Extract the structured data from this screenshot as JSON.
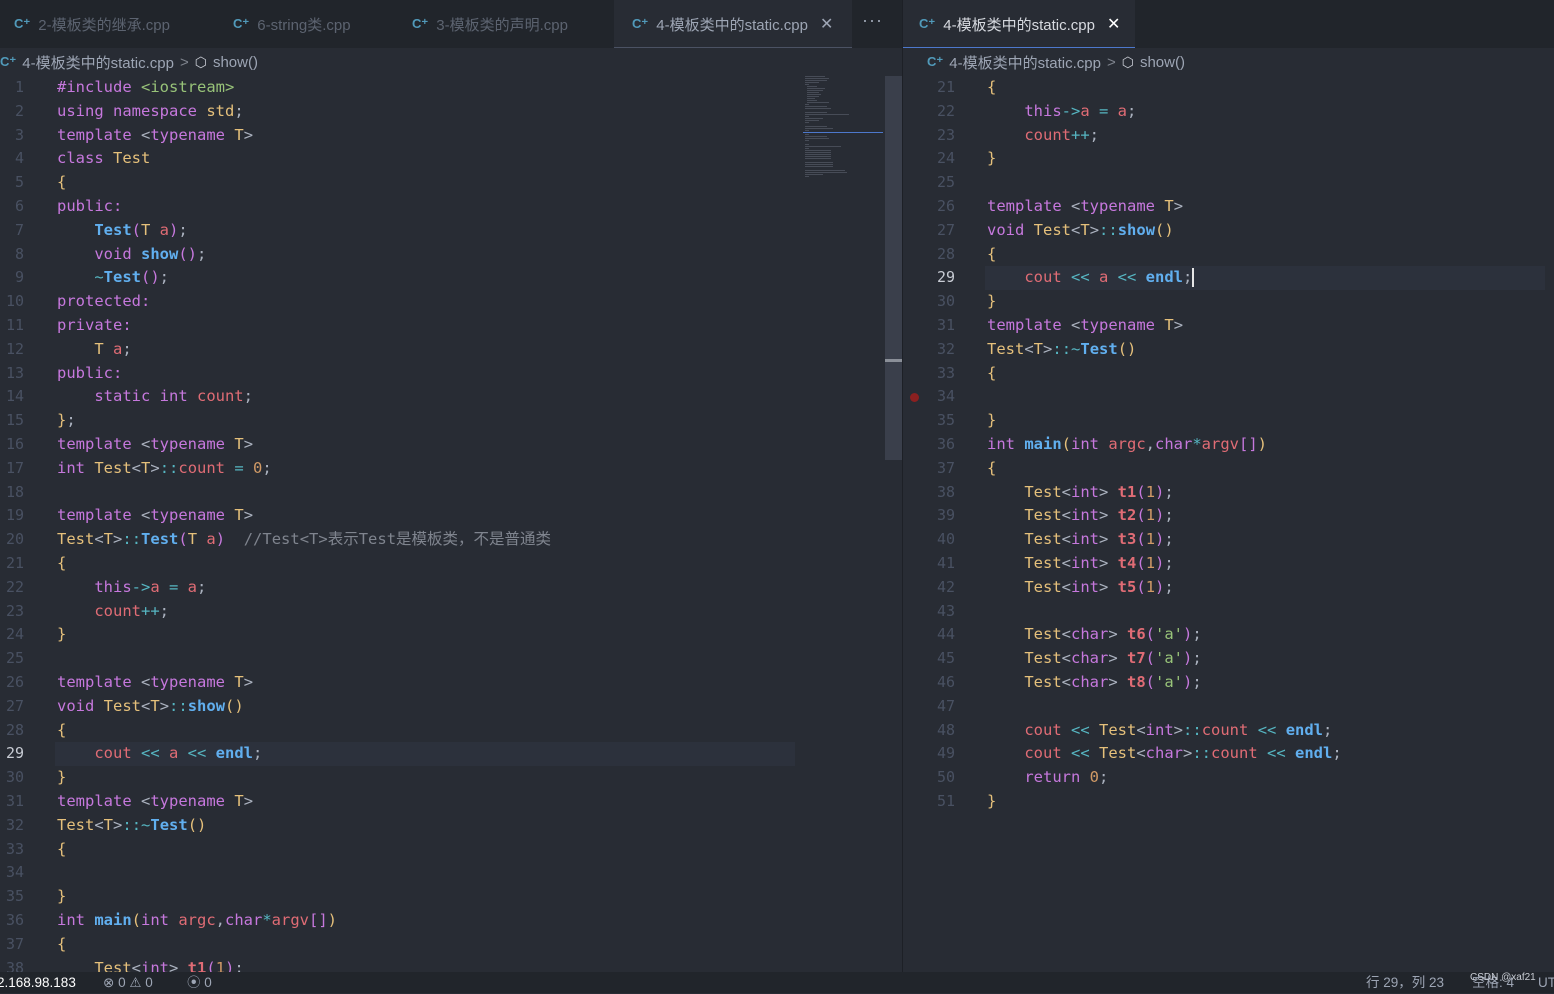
{
  "tabs_left": [
    {
      "label": "2-模板类的继承.cpp",
      "icon": "cpp-file-icon",
      "active": false
    },
    {
      "label": "6-string类.cpp",
      "icon": "cpp-file-icon",
      "active": false
    },
    {
      "label": "3-模板类的声明.cpp",
      "icon": "cpp-file-icon",
      "active": false
    },
    {
      "label": "4-模板类中的static.cpp",
      "icon": "cpp-file-icon",
      "active": false
    }
  ],
  "tab_right": {
    "label": "4-模板类中的static.cpp",
    "icon": "cpp-file-icon",
    "active": true
  },
  "more_actions": "···",
  "close_glyph": "✕",
  "breadcrumb": {
    "file": "4-模板类中的static.cpp",
    "symbol": "show()",
    "separator": ">"
  },
  "left_editor": {
    "first_line": 1,
    "current_line": 29,
    "lines": [
      [
        [
          "#include ",
          "kw"
        ],
        [
          "<iostream>",
          "st"
        ]
      ],
      [
        [
          "using ",
          "kw"
        ],
        [
          "namespace ",
          "kw"
        ],
        [
          "std",
          "ty"
        ],
        [
          ";",
          "pl"
        ]
      ],
      [
        [
          "template ",
          "kw"
        ],
        [
          "<",
          "pl"
        ],
        [
          "typename ",
          "kw"
        ],
        [
          "T",
          "ty"
        ],
        [
          ">",
          "pl"
        ]
      ],
      [
        [
          "class ",
          "kw"
        ],
        [
          "Test",
          "ty"
        ]
      ],
      [
        [
          "{",
          "b1"
        ]
      ],
      [
        [
          "public:",
          "kw"
        ]
      ],
      [
        [
          "    ",
          "pl"
        ],
        [
          "Test",
          "fn"
        ],
        [
          "(",
          "b2"
        ],
        [
          "T ",
          "ty"
        ],
        [
          "a",
          "va"
        ],
        [
          ")",
          "b2"
        ],
        [
          ";",
          "pl"
        ]
      ],
      [
        [
          "    ",
          "pl"
        ],
        [
          "void ",
          "kw"
        ],
        [
          "show",
          "fn"
        ],
        [
          "()",
          "b2"
        ],
        [
          ";",
          "pl"
        ]
      ],
      [
        [
          "    ",
          "pl"
        ],
        [
          "~",
          "op"
        ],
        [
          "Test",
          "fn"
        ],
        [
          "()",
          "b2"
        ],
        [
          ";",
          "pl"
        ]
      ],
      [
        [
          "protected:",
          "kw"
        ]
      ],
      [
        [
          "private:",
          "kw"
        ]
      ],
      [
        [
          "    ",
          "pl"
        ],
        [
          "T ",
          "ty"
        ],
        [
          "a",
          "va"
        ],
        [
          ";",
          "pl"
        ]
      ],
      [
        [
          "public:",
          "kw"
        ]
      ],
      [
        [
          "    ",
          "pl"
        ],
        [
          "static ",
          "kw"
        ],
        [
          "int ",
          "kw"
        ],
        [
          "count",
          "va"
        ],
        [
          ";",
          "pl"
        ]
      ],
      [
        [
          "}",
          "b1"
        ],
        [
          ";",
          "pl"
        ]
      ],
      [
        [
          "template ",
          "kw"
        ],
        [
          "<",
          "pl"
        ],
        [
          "typename ",
          "kw"
        ],
        [
          "T",
          "ty"
        ],
        [
          ">",
          "pl"
        ]
      ],
      [
        [
          "int ",
          "kw"
        ],
        [
          "Test",
          "ty"
        ],
        [
          "<",
          "pl"
        ],
        [
          "T",
          "ty"
        ],
        [
          ">",
          "pl"
        ],
        [
          "::",
          "op"
        ],
        [
          "count ",
          "va"
        ],
        [
          "= ",
          "op"
        ],
        [
          "0",
          "nu"
        ],
        [
          ";",
          "pl"
        ]
      ],
      [],
      [
        [
          "template ",
          "kw"
        ],
        [
          "<",
          "pl"
        ],
        [
          "typename ",
          "kw"
        ],
        [
          "T",
          "ty"
        ],
        [
          ">",
          "pl"
        ]
      ],
      [
        [
          "Test",
          "ty"
        ],
        [
          "<",
          "pl"
        ],
        [
          "T",
          "ty"
        ],
        [
          ">",
          "pl"
        ],
        [
          "::",
          "op"
        ],
        [
          "Test",
          "fn"
        ],
        [
          "(",
          "b2"
        ],
        [
          "T ",
          "ty"
        ],
        [
          "a",
          "va"
        ],
        [
          ")",
          "b2"
        ],
        [
          "  //Test<T>表示Test是模板类，不是普通类",
          "cm"
        ]
      ],
      [
        [
          "{",
          "b1"
        ]
      ],
      [
        [
          "    ",
          "pl"
        ],
        [
          "this",
          "kw"
        ],
        [
          "->",
          "op"
        ],
        [
          "a ",
          "va"
        ],
        [
          "= ",
          "op"
        ],
        [
          "a",
          "va"
        ],
        [
          ";",
          "pl"
        ]
      ],
      [
        [
          "    ",
          "pl"
        ],
        [
          "count",
          "va"
        ],
        [
          "++",
          "op"
        ],
        [
          ";",
          "pl"
        ]
      ],
      [
        [
          "}",
          "b1"
        ]
      ],
      [],
      [
        [
          "template ",
          "kw"
        ],
        [
          "<",
          "pl"
        ],
        [
          "typename ",
          "kw"
        ],
        [
          "T",
          "ty"
        ],
        [
          ">",
          "pl"
        ]
      ],
      [
        [
          "void ",
          "kw"
        ],
        [
          "Test",
          "ty"
        ],
        [
          "<",
          "pl"
        ],
        [
          "T",
          "ty"
        ],
        [
          ">",
          "pl"
        ],
        [
          "::",
          "op"
        ],
        [
          "show",
          "fn"
        ],
        [
          "()",
          "b1"
        ]
      ],
      [
        [
          "{",
          "b1"
        ]
      ],
      [
        [
          "    ",
          "pl"
        ],
        [
          "cout ",
          "va"
        ],
        [
          "<< ",
          "op"
        ],
        [
          "a ",
          "va"
        ],
        [
          "<< ",
          "op"
        ],
        [
          "endl",
          "fn"
        ],
        [
          ";",
          "pl"
        ]
      ],
      [
        [
          "}",
          "b1"
        ]
      ],
      [
        [
          "template ",
          "kw"
        ],
        [
          "<",
          "pl"
        ],
        [
          "typename ",
          "kw"
        ],
        [
          "T",
          "ty"
        ],
        [
          ">",
          "pl"
        ]
      ],
      [
        [
          "Test",
          "ty"
        ],
        [
          "<",
          "pl"
        ],
        [
          "T",
          "ty"
        ],
        [
          ">",
          "pl"
        ],
        [
          "::",
          "op"
        ],
        [
          "~",
          "op"
        ],
        [
          "Test",
          "fn"
        ],
        [
          "()",
          "b1"
        ]
      ],
      [
        [
          "{",
          "b1"
        ]
      ],
      [],
      [
        [
          "}",
          "b1"
        ]
      ],
      [
        [
          "int ",
          "kw"
        ],
        [
          "main",
          "fn"
        ],
        [
          "(",
          "b1"
        ],
        [
          "int ",
          "kw"
        ],
        [
          "argc",
          "va"
        ],
        [
          ",",
          "pl"
        ],
        [
          "char",
          "kw"
        ],
        [
          "*",
          "op"
        ],
        [
          "argv",
          "va"
        ],
        [
          "[]",
          "b2"
        ],
        [
          ")",
          "b1"
        ]
      ],
      [
        [
          "{",
          "b1"
        ]
      ],
      [
        [
          "    ",
          "pl"
        ],
        [
          "Test",
          "ty"
        ],
        [
          "<",
          "pl"
        ],
        [
          "int",
          "kw"
        ],
        [
          "> ",
          "pl"
        ],
        [
          "t1",
          "fnb"
        ],
        [
          "(",
          "b2"
        ],
        [
          "1",
          "nu"
        ],
        [
          ")",
          "b2"
        ],
        [
          ";",
          "pl"
        ]
      ]
    ]
  },
  "right_editor": {
    "first_line": 21,
    "current_line": 29,
    "breakpoint_line": 34,
    "lines": [
      [
        [
          "{",
          "b1"
        ]
      ],
      [
        [
          "    ",
          "pl"
        ],
        [
          "this",
          "kw"
        ],
        [
          "->",
          "op"
        ],
        [
          "a ",
          "va"
        ],
        [
          "= ",
          "op"
        ],
        [
          "a",
          "va"
        ],
        [
          ";",
          "pl"
        ]
      ],
      [
        [
          "    ",
          "pl"
        ],
        [
          "count",
          "va"
        ],
        [
          "++",
          "op"
        ],
        [
          ";",
          "pl"
        ]
      ],
      [
        [
          "}",
          "b1"
        ]
      ],
      [],
      [
        [
          "template ",
          "kw"
        ],
        [
          "<",
          "pl"
        ],
        [
          "typename ",
          "kw"
        ],
        [
          "T",
          "ty"
        ],
        [
          ">",
          "pl"
        ]
      ],
      [
        [
          "void ",
          "kw"
        ],
        [
          "Test",
          "ty"
        ],
        [
          "<",
          "pl"
        ],
        [
          "T",
          "ty"
        ],
        [
          ">",
          "pl"
        ],
        [
          "::",
          "op"
        ],
        [
          "show",
          "fn"
        ],
        [
          "()",
          "b1"
        ]
      ],
      [
        [
          "{",
          "b1"
        ]
      ],
      [
        [
          "    ",
          "pl"
        ],
        [
          "cout ",
          "va"
        ],
        [
          "<< ",
          "op"
        ],
        [
          "a ",
          "va"
        ],
        [
          "<< ",
          "op"
        ],
        [
          "endl",
          "fn"
        ],
        [
          ";",
          "pl"
        ]
      ],
      [
        [
          "}",
          "b1"
        ]
      ],
      [
        [
          "template ",
          "kw"
        ],
        [
          "<",
          "pl"
        ],
        [
          "typename ",
          "kw"
        ],
        [
          "T",
          "ty"
        ],
        [
          ">",
          "pl"
        ]
      ],
      [
        [
          "Test",
          "ty"
        ],
        [
          "<",
          "pl"
        ],
        [
          "T",
          "ty"
        ],
        [
          ">",
          "pl"
        ],
        [
          "::",
          "op"
        ],
        [
          "~",
          "op"
        ],
        [
          "Test",
          "fn"
        ],
        [
          "()",
          "b1"
        ]
      ],
      [
        [
          "{",
          "b1"
        ]
      ],
      [],
      [
        [
          "}",
          "b1"
        ]
      ],
      [
        [
          "int ",
          "kw"
        ],
        [
          "main",
          "fn"
        ],
        [
          "(",
          "b1"
        ],
        [
          "int ",
          "kw"
        ],
        [
          "argc",
          "va"
        ],
        [
          ",",
          "pl"
        ],
        [
          "char",
          "kw"
        ],
        [
          "*",
          "op"
        ],
        [
          "argv",
          "va"
        ],
        [
          "[]",
          "b2"
        ],
        [
          ")",
          "b1"
        ]
      ],
      [
        [
          "{",
          "b1"
        ]
      ],
      [
        [
          "    ",
          "pl"
        ],
        [
          "Test",
          "ty"
        ],
        [
          "<",
          "pl"
        ],
        [
          "int",
          "kw"
        ],
        [
          "> ",
          "pl"
        ],
        [
          "t1",
          "fnb"
        ],
        [
          "(",
          "b2"
        ],
        [
          "1",
          "nu"
        ],
        [
          ")",
          "b2"
        ],
        [
          ";",
          "pl"
        ]
      ],
      [
        [
          "    ",
          "pl"
        ],
        [
          "Test",
          "ty"
        ],
        [
          "<",
          "pl"
        ],
        [
          "int",
          "kw"
        ],
        [
          "> ",
          "pl"
        ],
        [
          "t2",
          "fnb"
        ],
        [
          "(",
          "b2"
        ],
        [
          "1",
          "nu"
        ],
        [
          ")",
          "b2"
        ],
        [
          ";",
          "pl"
        ]
      ],
      [
        [
          "    ",
          "pl"
        ],
        [
          "Test",
          "ty"
        ],
        [
          "<",
          "pl"
        ],
        [
          "int",
          "kw"
        ],
        [
          "> ",
          "pl"
        ],
        [
          "t3",
          "fnb"
        ],
        [
          "(",
          "b2"
        ],
        [
          "1",
          "nu"
        ],
        [
          ")",
          "b2"
        ],
        [
          ";",
          "pl"
        ]
      ],
      [
        [
          "    ",
          "pl"
        ],
        [
          "Test",
          "ty"
        ],
        [
          "<",
          "pl"
        ],
        [
          "int",
          "kw"
        ],
        [
          "> ",
          "pl"
        ],
        [
          "t4",
          "fnb"
        ],
        [
          "(",
          "b2"
        ],
        [
          "1",
          "nu"
        ],
        [
          ")",
          "b2"
        ],
        [
          ";",
          "pl"
        ]
      ],
      [
        [
          "    ",
          "pl"
        ],
        [
          "Test",
          "ty"
        ],
        [
          "<",
          "pl"
        ],
        [
          "int",
          "kw"
        ],
        [
          "> ",
          "pl"
        ],
        [
          "t5",
          "fnb"
        ],
        [
          "(",
          "b2"
        ],
        [
          "1",
          "nu"
        ],
        [
          ")",
          "b2"
        ],
        [
          ";",
          "pl"
        ]
      ],
      [],
      [
        [
          "    ",
          "pl"
        ],
        [
          "Test",
          "ty"
        ],
        [
          "<",
          "pl"
        ],
        [
          "char",
          "kw"
        ],
        [
          "> ",
          "pl"
        ],
        [
          "t6",
          "fnb"
        ],
        [
          "(",
          "b2"
        ],
        [
          "'a'",
          "st"
        ],
        [
          ")",
          "b2"
        ],
        [
          ";",
          "pl"
        ]
      ],
      [
        [
          "    ",
          "pl"
        ],
        [
          "Test",
          "ty"
        ],
        [
          "<",
          "pl"
        ],
        [
          "char",
          "kw"
        ],
        [
          "> ",
          "pl"
        ],
        [
          "t7",
          "fnb"
        ],
        [
          "(",
          "b2"
        ],
        [
          "'a'",
          "st"
        ],
        [
          ")",
          "b2"
        ],
        [
          ";",
          "pl"
        ]
      ],
      [
        [
          "    ",
          "pl"
        ],
        [
          "Test",
          "ty"
        ],
        [
          "<",
          "pl"
        ],
        [
          "char",
          "kw"
        ],
        [
          "> ",
          "pl"
        ],
        [
          "t8",
          "fnb"
        ],
        [
          "(",
          "b2"
        ],
        [
          "'a'",
          "st"
        ],
        [
          ")",
          "b2"
        ],
        [
          ";",
          "pl"
        ]
      ],
      [],
      [
        [
          "    ",
          "pl"
        ],
        [
          "cout ",
          "va"
        ],
        [
          "<< ",
          "op"
        ],
        [
          "Test",
          "ty"
        ],
        [
          "<",
          "pl"
        ],
        [
          "int",
          "kw"
        ],
        [
          ">",
          "pl"
        ],
        [
          "::",
          "op"
        ],
        [
          "count ",
          "va"
        ],
        [
          "<< ",
          "op"
        ],
        [
          "endl",
          "fn"
        ],
        [
          ";",
          "pl"
        ]
      ],
      [
        [
          "    ",
          "pl"
        ],
        [
          "cout ",
          "va"
        ],
        [
          "<< ",
          "op"
        ],
        [
          "Test",
          "ty"
        ],
        [
          "<",
          "pl"
        ],
        [
          "char",
          "kw"
        ],
        [
          ">",
          "pl"
        ],
        [
          "::",
          "op"
        ],
        [
          "count ",
          "va"
        ],
        [
          "<< ",
          "op"
        ],
        [
          "endl",
          "fn"
        ],
        [
          ";",
          "pl"
        ]
      ],
      [
        [
          "    ",
          "pl"
        ],
        [
          "return ",
          "kw"
        ],
        [
          "0",
          "nu"
        ],
        [
          ";",
          "pl"
        ]
      ],
      [
        [
          "}",
          "b1"
        ]
      ]
    ]
  },
  "status": {
    "ip": "2.168.98.183",
    "errors_icon": "error-icon",
    "errors": "0",
    "warnings_icon": "warning-icon",
    "warnings": "0",
    "ports_icon": "broadcast-icon",
    "ports": "0",
    "position": "行 29，列 23",
    "indent": "空格: 4",
    "encoding": "UT",
    "watermark": "CSDN @xaf21"
  }
}
